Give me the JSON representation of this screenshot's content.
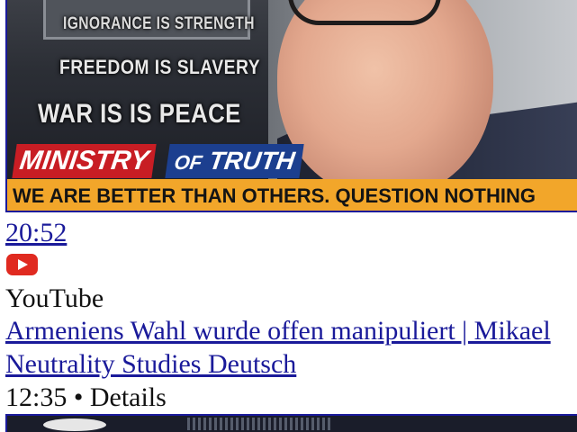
{
  "result": {
    "thumbnail": {
      "slogans": [
        "IGNORANCE IS STRENGTH",
        "FREEDOM IS SLAVERY",
        "WAR IS IS PEACE"
      ],
      "ministry_left": "MINISTRY",
      "ministry_of": "OF",
      "ministry_right": "TRUTH",
      "banner": "WE ARE BETTER THAN OTHERS. QUESTION NOTHING",
      "colors": {
        "banner": "#f2a62a",
        "ministry_red": "#c81d24",
        "ministry_blue": "#1c3f8f"
      }
    },
    "duration": "20:52",
    "source_icon": "youtube-icon",
    "source_name": "YouTube",
    "title": "Armeniens Wahl wurde offen manipuliert | Mikael",
    "channel": "Neutrality Studies Deutsch",
    "meta": "12:35 • Details"
  },
  "colors": {
    "link": "#1a1a9a",
    "youtube": "#e02a20"
  }
}
